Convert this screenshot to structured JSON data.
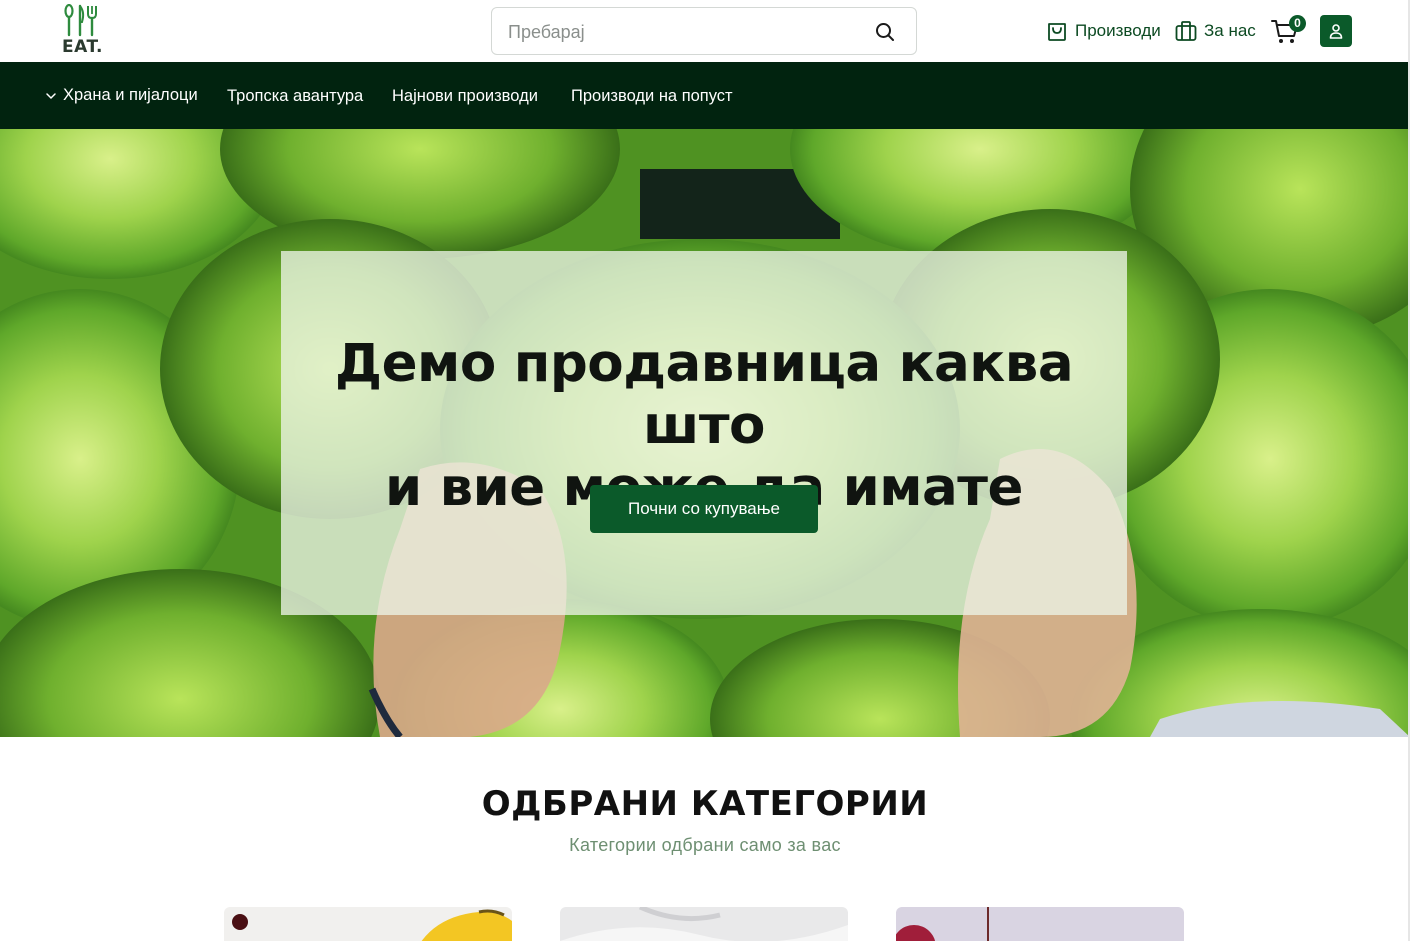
{
  "header": {
    "logo_text": "EAT.",
    "search_placeholder": "Пребарај",
    "products_label": "Производи",
    "about_label": "За нас",
    "cart_count": "0"
  },
  "menu": {
    "items": [
      {
        "label": "Храна и пијалоци",
        "has_dropdown": true
      },
      {
        "label": "Тропска авантура"
      },
      {
        "label": "Најнови производи"
      },
      {
        "label": "Производи на попуст"
      }
    ]
  },
  "hero": {
    "title_line1": "Демо продавница каква што",
    "title_line2": "и вие може да имате",
    "cta_label": "Почни со купување"
  },
  "categories": {
    "title": "ОДБРАНИ КАТЕГОРИИ",
    "subtitle": "Категории одбрани само за вас"
  },
  "colors": {
    "brand_green": "#0b5a2a",
    "menubar_bg": "#01230f",
    "subtitle_green": "#6e8f72"
  },
  "icons": {
    "search": "search-icon",
    "products": "shopping-bag-icon",
    "about": "briefcase-icon",
    "cart": "cart-icon",
    "account": "user-icon",
    "dropdown": "chevron-down-icon"
  }
}
